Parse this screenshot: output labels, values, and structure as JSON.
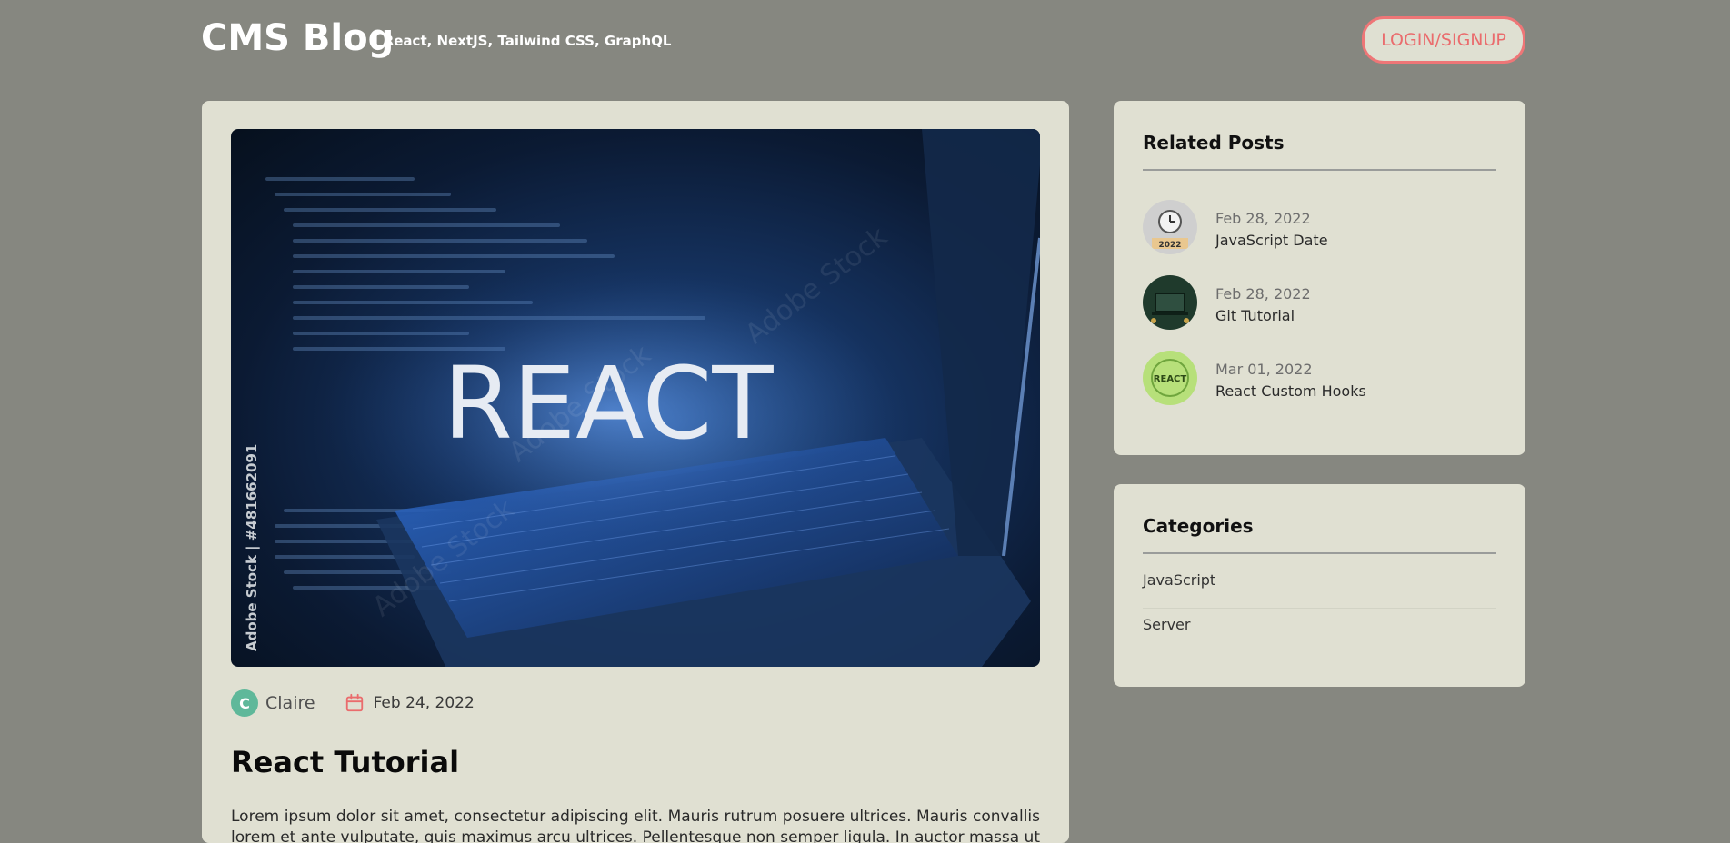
{
  "header": {
    "title": "CMS Blog",
    "subtitle": "| React, NextJS, Tailwind CSS, GraphQL",
    "login_label": "LOGIN/SIGNUP"
  },
  "post": {
    "hero_text": "REACT",
    "watermark_side": "Adobe Stock | #481662091",
    "watermark_diag": "Adobe Stock",
    "author_initial": "C",
    "author": "Claire",
    "date": "Feb 24, 2022",
    "title": "React Tutorial",
    "body": "Lorem ipsum dolor sit amet, consectetur adipiscing elit. Mauris rutrum posuere ultrices. Mauris convallis lorem et ante vulputate, quis maximus arcu ultrices. Pellentesque non semper ligula. In auctor massa ut ante"
  },
  "related": {
    "title": "Related Posts",
    "items": [
      {
        "date": "Feb 28, 2022",
        "title": "JavaScript Date",
        "thumb_text": "2022"
      },
      {
        "date": "Feb 28, 2022",
        "title": "Git Tutorial"
      },
      {
        "date": "Mar 01, 2022",
        "title": "React Custom Hooks",
        "thumb_text": "REACT"
      }
    ]
  },
  "categories": {
    "title": "Categories",
    "items": [
      "JavaScript",
      "Server"
    ]
  },
  "colors": {
    "background": "#868780",
    "card": "#e0e0d2",
    "accent": "#ee7677"
  }
}
